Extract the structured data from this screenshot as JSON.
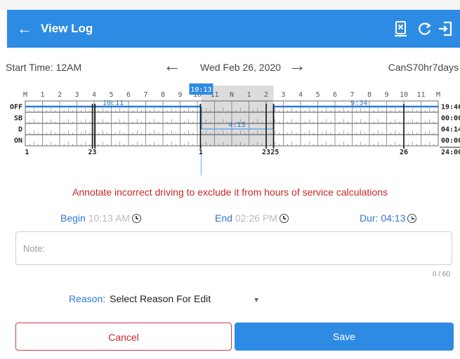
{
  "header": {
    "title": "View Log",
    "icons": [
      "back-arrow-icon",
      "document-x-icon",
      "refresh-icon",
      "logout-icon"
    ],
    "bg_color": "#2e8be3"
  },
  "datebar": {
    "start_time": "Start Time: 12AM",
    "date": "Wed Feb 26, 2020",
    "ruleset": "CanS70hr7days"
  },
  "graph": {
    "hour_labels": [
      "M",
      "1",
      "2",
      "3",
      "4",
      "5",
      "6",
      "7",
      "8",
      "9",
      "10",
      "11",
      "N",
      "1",
      "2",
      "3",
      "4",
      "5",
      "6",
      "7",
      "8",
      "9",
      "10",
      "11",
      "M"
    ],
    "selected_time": "10:13",
    "status_labels": [
      "OFF",
      "SB",
      "D",
      "ON"
    ],
    "totals": [
      "19:46",
      "00:00",
      "04:14",
      "00:00",
      "24:00"
    ],
    "duration_labels": [
      {
        "text": "10:11",
        "hour": 5.1
      },
      {
        "text": "4:13",
        "hour": 12.3
      },
      {
        "text": "9:34",
        "hour": 19.4
      }
    ],
    "bottom_numbers": [
      {
        "text": "1",
        "hour": 0.1
      },
      {
        "text": "23",
        "hour": 3.9
      },
      {
        "text": "1",
        "hour": 10.2
      },
      {
        "text": "23",
        "hour": 14.0
      },
      {
        "text": "25",
        "hour": 14.5
      },
      {
        "text": "26",
        "hour": 22.0
      }
    ],
    "status_segments": [
      {
        "status": "OFF",
        "start": 0.0,
        "end": 10.22
      },
      {
        "status": "D",
        "start": 10.22,
        "end": 14.43
      },
      {
        "status": "OFF",
        "start": 14.43,
        "end": 24.0
      }
    ],
    "highlight": {
      "start": 10.22,
      "end": 14.43
    }
  },
  "annotation": "Annotate incorrect driving to exclude it from hours of service calculations",
  "edit": {
    "begin_label": "Begin",
    "begin_value": "10:13 AM",
    "end_label": "End",
    "end_value": "02:26 PM",
    "dur_label": "Dur:",
    "dur_value": "04:13"
  },
  "note": {
    "placeholder": "Note:",
    "counter": "0 / 60"
  },
  "reason": {
    "label": "Reason:",
    "value": "Select Reason For Edit"
  },
  "buttons": {
    "cancel": "Cancel",
    "save": "Save"
  }
}
